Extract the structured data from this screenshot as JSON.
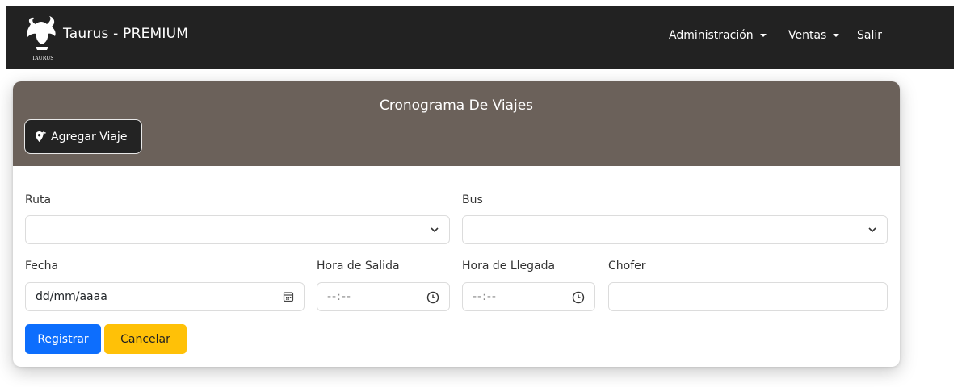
{
  "navbar": {
    "brand": "Taurus - PREMIUM",
    "logo_text": "TAURUS",
    "menu": [
      {
        "label": "Administración",
        "has_dropdown": true
      },
      {
        "label": "Ventas",
        "has_dropdown": true
      },
      {
        "label": "Salir",
        "has_dropdown": false
      }
    ]
  },
  "card": {
    "title": "Cronograma De Viajes",
    "add_button_label": "Agregar Viaje",
    "header_color": "#6b615a"
  },
  "form": {
    "ruta": {
      "label": "Ruta",
      "value": ""
    },
    "bus": {
      "label": "Bus",
      "value": ""
    },
    "fecha": {
      "label": "Fecha",
      "value": "dd/mm/aaaa"
    },
    "hora_salida": {
      "label": "Hora de Salida",
      "value": "--:--"
    },
    "hora_llegada": {
      "label": "Hora de Llegada",
      "value": "--:--"
    },
    "chofer": {
      "label": "Chofer",
      "value": ""
    }
  },
  "actions": {
    "submit_label": "Registrar",
    "cancel_label": "Cancelar",
    "primary_color": "#0d6efd",
    "warning_color": "#ffc107"
  }
}
